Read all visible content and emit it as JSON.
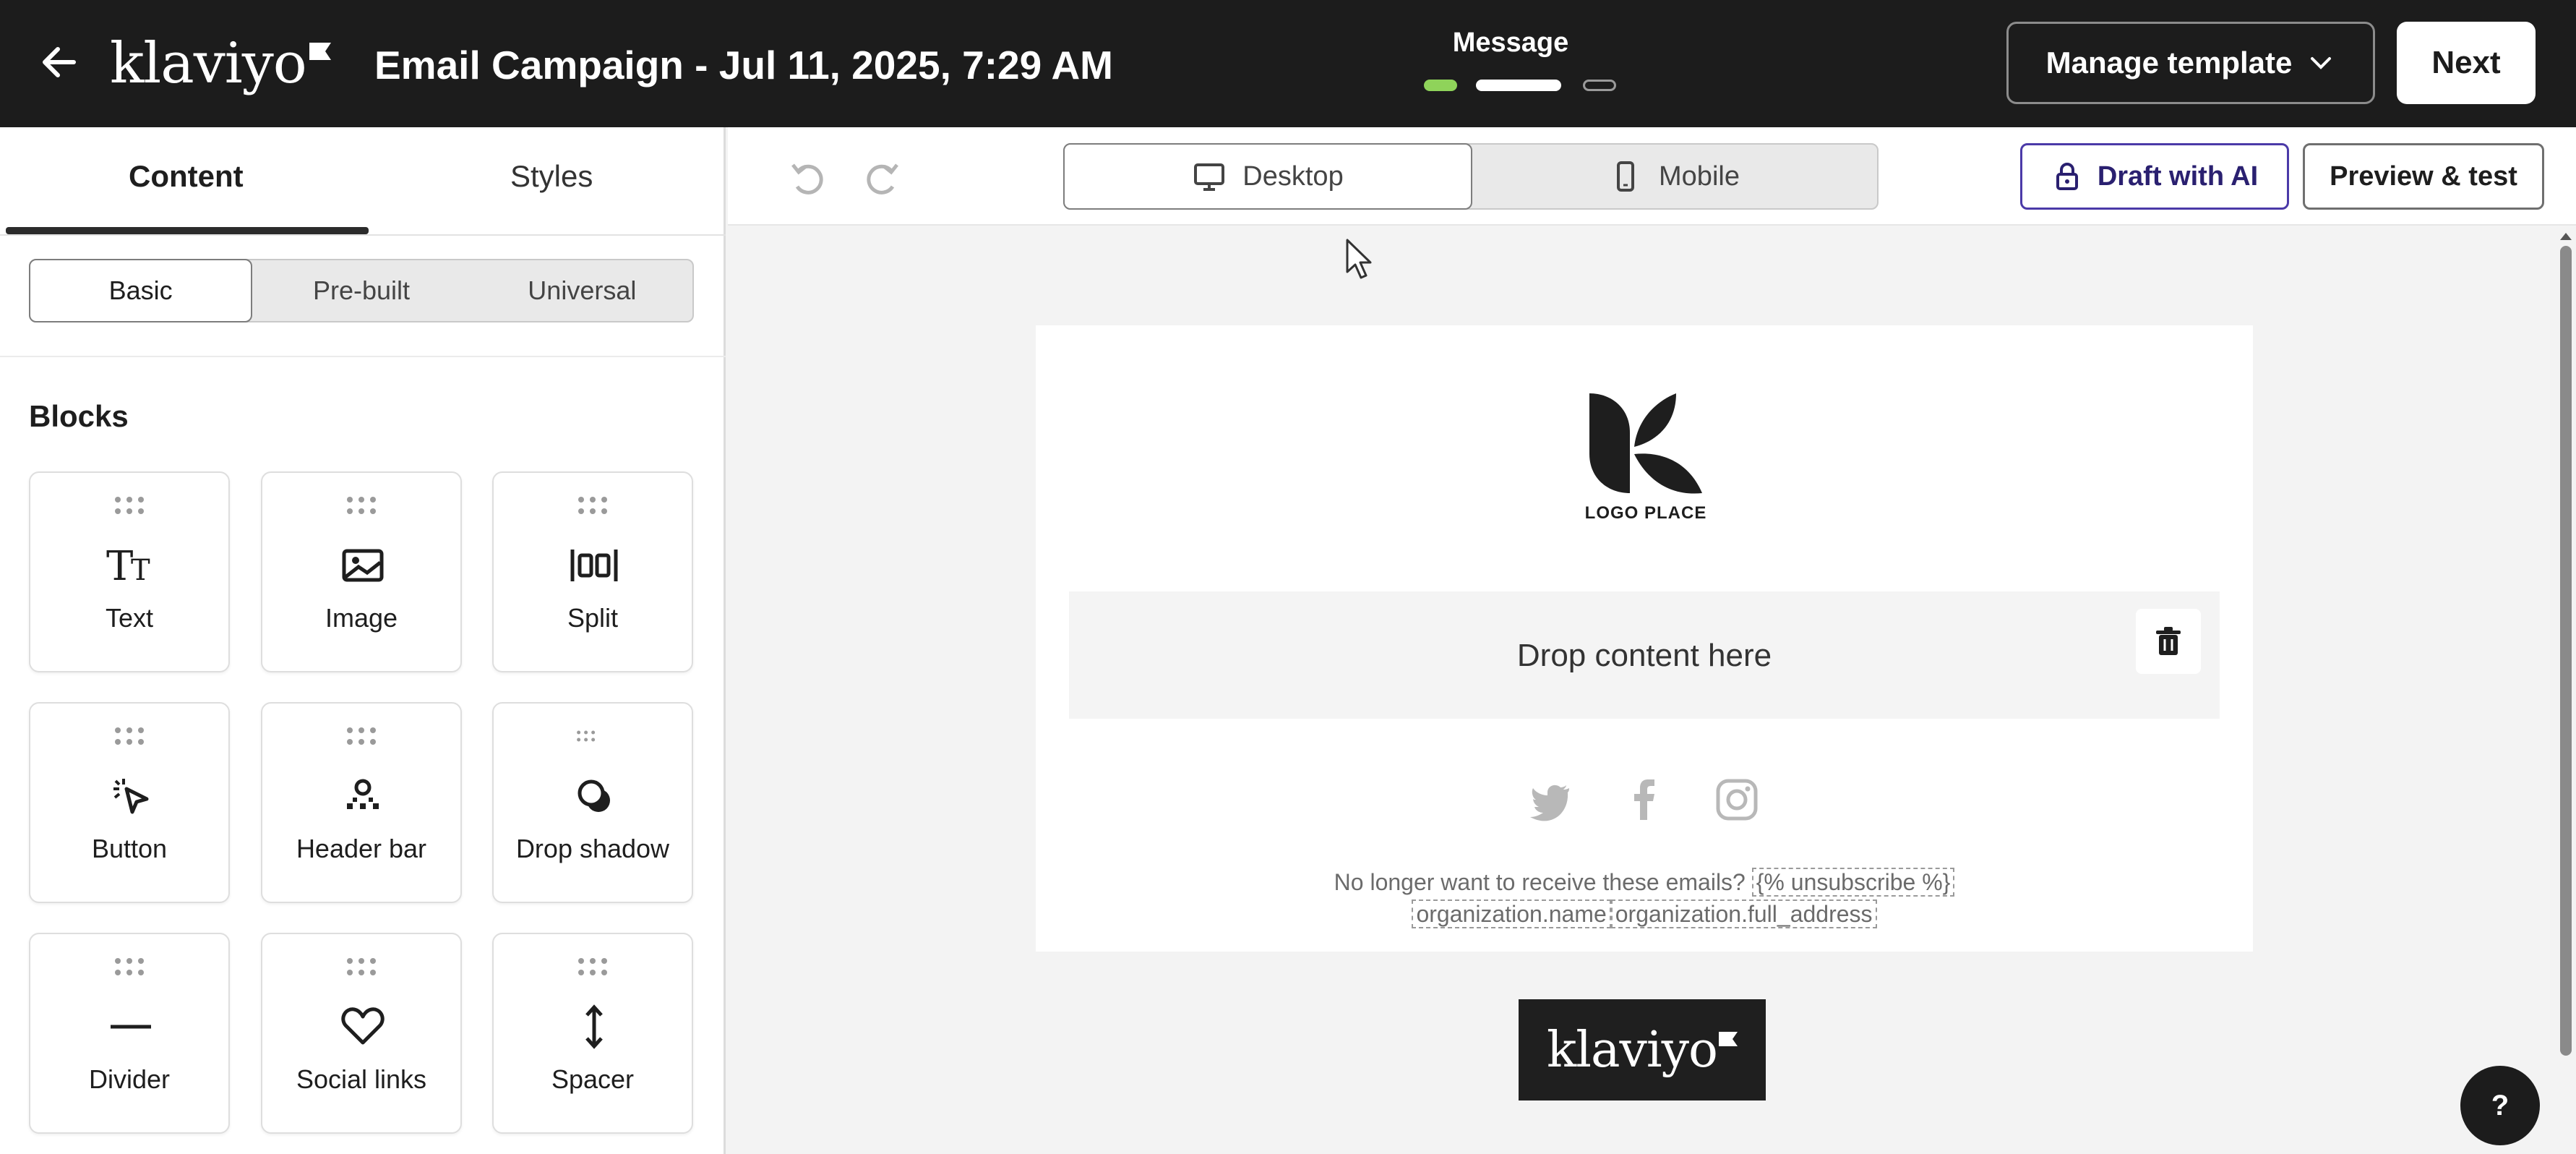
{
  "header": {
    "back_icon": "arrow-left-icon",
    "logo_text": "klaviyo",
    "campaign_title": "Email Campaign - Jul 11, 2025, 7:29 AM",
    "step_label": "Message",
    "step_count": 3,
    "current_step": 2,
    "manage_template_label": "Manage template",
    "next_label": "Next"
  },
  "left_panel": {
    "tabs": [
      "Content",
      "Styles"
    ],
    "active_tab": "Content",
    "segments": [
      "Basic",
      "Pre-built",
      "Universal"
    ],
    "active_segment": "Basic",
    "blocks_title": "Blocks",
    "blocks": [
      {
        "label": "Text",
        "icon": "text-icon"
      },
      {
        "label": "Image",
        "icon": "image-icon"
      },
      {
        "label": "Split",
        "icon": "split-columns-icon"
      },
      {
        "label": "Button",
        "icon": "button-click-icon"
      },
      {
        "label": "Header bar",
        "icon": "header-bar-icon"
      },
      {
        "label": "Drop shadow",
        "icon": "drop-shadow-icon"
      },
      {
        "label": "Divider",
        "icon": "divider-icon"
      },
      {
        "label": "Social links",
        "icon": "heart-icon"
      },
      {
        "label": "Spacer",
        "icon": "spacer-arrows-icon"
      }
    ]
  },
  "toolbar": {
    "views": [
      "Desktop",
      "Mobile"
    ],
    "active_view": "Desktop",
    "draft_ai_label": "Draft with AI",
    "preview_label": "Preview & test"
  },
  "email": {
    "logo_text": "LOGO PLACE",
    "drop_text": "Drop content here",
    "social_icons": [
      "twitter-icon",
      "facebook-icon",
      "instagram-icon"
    ],
    "footer_prefix": "No longer want to receive these emails?",
    "unsubscribe_tag": "{% unsubscribe %}",
    "org_name_tag": "organization.name",
    "org_address_tag": "organization.full_address",
    "badge_text": "klaviyo"
  },
  "help_label": "?",
  "colors": {
    "topbar": "#1c1c1c",
    "progress_active": "#8fd35a",
    "ai_accent": "#4b3aa8"
  }
}
